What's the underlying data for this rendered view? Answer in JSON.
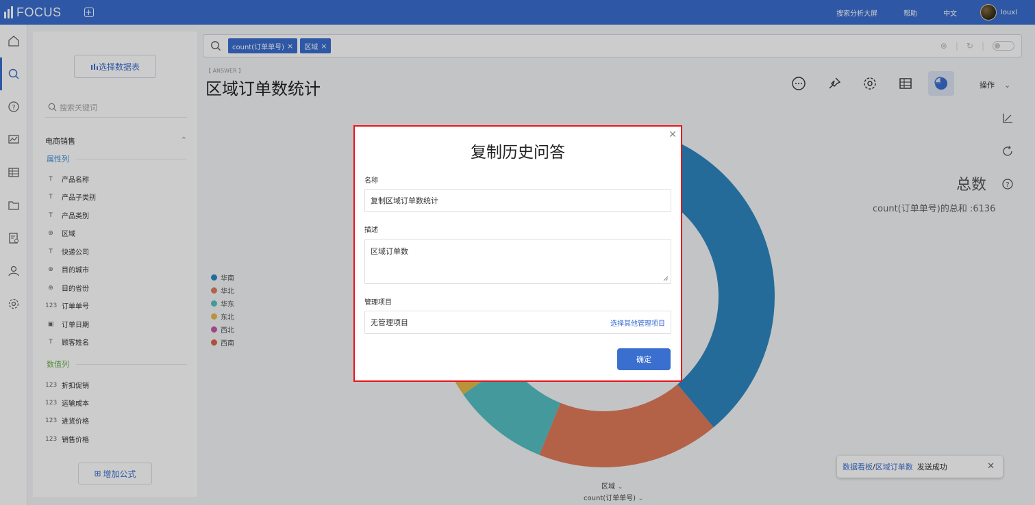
{
  "app": {
    "logo_text": "FOCUS",
    "top_links": [
      "搜索分析大屏",
      "帮助",
      "中文"
    ],
    "user_name": "louxl"
  },
  "sidebar": {
    "select_table_label": "选择数据表",
    "search_placeholder": "搜索关键词",
    "group_name": "电商销售",
    "attr_section": "属性列",
    "attr_fields": [
      {
        "icon": "text-icon",
        "label": "产品名称"
      },
      {
        "icon": "text-icon",
        "label": "产品子类别"
      },
      {
        "icon": "text-icon",
        "label": "产品类别"
      },
      {
        "icon": "globe-icon",
        "label": "区域"
      },
      {
        "icon": "text-icon",
        "label": "快递公司"
      },
      {
        "icon": "globe-icon",
        "label": "目的城市"
      },
      {
        "icon": "globe-icon",
        "label": "目的省份"
      },
      {
        "icon": "number-icon",
        "label": "订单单号"
      },
      {
        "icon": "calendar-icon",
        "label": "订单日期"
      },
      {
        "icon": "text-icon",
        "label": "顾客姓名"
      }
    ],
    "num_section": "数值列",
    "num_fields": [
      {
        "icon": "number-icon",
        "label": "折扣促销"
      },
      {
        "icon": "number-icon",
        "label": "运输成本"
      },
      {
        "icon": "number-icon",
        "label": "进货价格"
      },
      {
        "icon": "number-icon",
        "label": "销售价格"
      }
    ],
    "add_formula_label": "增加公式"
  },
  "search": {
    "tokens": [
      "count(订单单号)",
      "区域"
    ]
  },
  "answer": {
    "tag": "【 ANSWER 】",
    "title": "区域订单数统计",
    "ops_label": "操作",
    "total_label": "总数",
    "total_value": "count(订单单号)的总和 :6136"
  },
  "chart_data": {
    "type": "pie",
    "categories": [
      "华南",
      "华北",
      "华东",
      "东北",
      "西北",
      "西南"
    ],
    "colors": [
      "#2e86c1",
      "#e07b5a",
      "#55c0c4",
      "#e6b84a",
      "#c45aa6",
      "#d9634f"
    ],
    "x_axis_label": "区域",
    "y_axis_label": "count(订单单号)",
    "total": 6136
  },
  "toast": {
    "link1": "数据看板",
    "separator": " / ",
    "link2": "区域订单数",
    "message": "发送成功"
  },
  "modal": {
    "title": "复制历史问答",
    "name_label": "名称",
    "name_value": "复制区域订单数统计",
    "desc_label": "描述",
    "desc_value": "区域订单数",
    "project_label": "管理项目",
    "project_value": "无管理项目",
    "project_link": "选择其他管理项目",
    "confirm_label": "确定"
  }
}
